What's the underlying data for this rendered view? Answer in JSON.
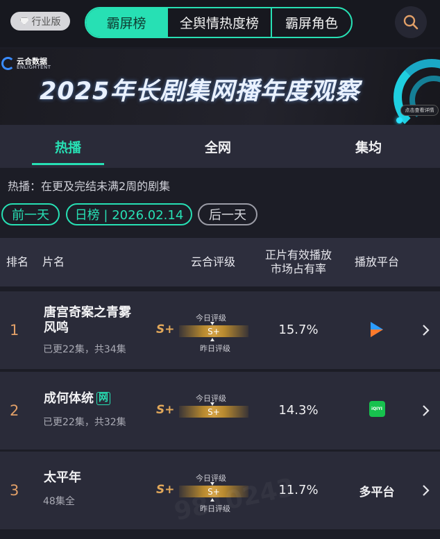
{
  "header": {
    "industry_label": "行业版",
    "tabs": [
      {
        "label": "霸屏榜",
        "active": true
      },
      {
        "label": "全舆情热度榜",
        "active": false
      },
      {
        "label": "霸屏角色",
        "active": false
      }
    ],
    "search_icon": "search-icon"
  },
  "banner": {
    "logo_cn": "云合数据",
    "logo_en": "ENLIGHTENT",
    "title": "2025年长剧集网播年度观察",
    "cta": "点击查看详情"
  },
  "subtabs": [
    {
      "label": "热播",
      "active": true
    },
    {
      "label": "全网",
      "active": false
    },
    {
      "label": "集均",
      "active": false
    }
  ],
  "description": "热播：在更及完结未满2周的剧集",
  "datebar": {
    "prev": "前一天",
    "current": "日榜 | 2026.02.14",
    "next": "后一天"
  },
  "table": {
    "headers": {
      "rank": "排名",
      "title": "片名",
      "rating": "云合评级",
      "share_line1": "正片有效播放",
      "share_line2": "市场占有率",
      "platform": "播放平台"
    },
    "rows": [
      {
        "rank": "1",
        "name_line1": "唐宫奇案之青雾",
        "name_line2": "风鸣",
        "tag": "",
        "episodes": "已更22集，共34集",
        "grade": "S+",
        "today_label": "今日评级",
        "band_grade": "S+",
        "yesterday_label": "昨日评级",
        "share": "15.7%",
        "platform_icon": "youku-icon",
        "platform_text": ""
      },
      {
        "rank": "2",
        "name_line1": "成何体统",
        "name_line2": "",
        "tag": "网",
        "episodes": "已更22集，共32集",
        "grade": "S+",
        "today_label": "今日评级",
        "band_grade": "S+",
        "yesterday_label": "",
        "share": "14.3%",
        "platform_icon": "iqiyi-icon",
        "platform_text": "iQIYI"
      },
      {
        "rank": "3",
        "name_line1": "太平年",
        "name_line2": "",
        "tag": "",
        "episodes": "48集全",
        "grade": "S+",
        "today_label": "今日评级",
        "band_grade": "S+",
        "yesterday_label": "昨日评级",
        "share": "11.7%",
        "platform_icon": "",
        "platform_text": "多平台"
      }
    ]
  },
  "watermark_text": "9810243"
}
